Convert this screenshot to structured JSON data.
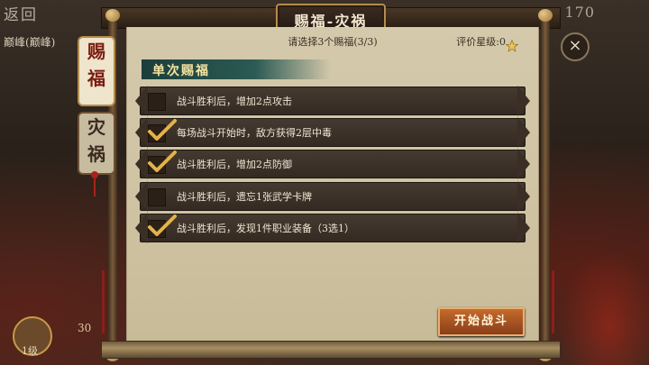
{
  "background": {
    "back_label": "返回",
    "player_name": "巅峰(巅峰)",
    "top_right_value": "170",
    "level_label": "1级",
    "stat_value": "30"
  },
  "window": {
    "title": "赐福-灾祸",
    "close_icon": "×"
  },
  "tabs": [
    {
      "label_1": "赐",
      "label_2": "福",
      "active": true
    },
    {
      "label_1": "灾",
      "label_2": "祸",
      "active": false
    }
  ],
  "panel": {
    "instruction": "请选择3个赐福(3/3)",
    "rating_label": "评价星级:0",
    "section_title": "单次赐福",
    "options": [
      {
        "text": "战斗胜利后，增加2点攻击",
        "checked": false
      },
      {
        "text": "每场战斗开始时，敌方获得2层中毒",
        "checked": true
      },
      {
        "text": "战斗胜利后，增加2点防御",
        "checked": true
      },
      {
        "text": "战斗胜利后，遗忘1张武学卡牌",
        "checked": false
      },
      {
        "text": "战斗胜利后，发现1件职业装备（3选1）",
        "checked": true
      }
    ],
    "start_button": "开始战斗"
  },
  "colors": {
    "accent": "#c46a2c",
    "section_header": "#2c5a54",
    "option_bg": "#3b2f25",
    "parchment": "#d4c9ab"
  }
}
